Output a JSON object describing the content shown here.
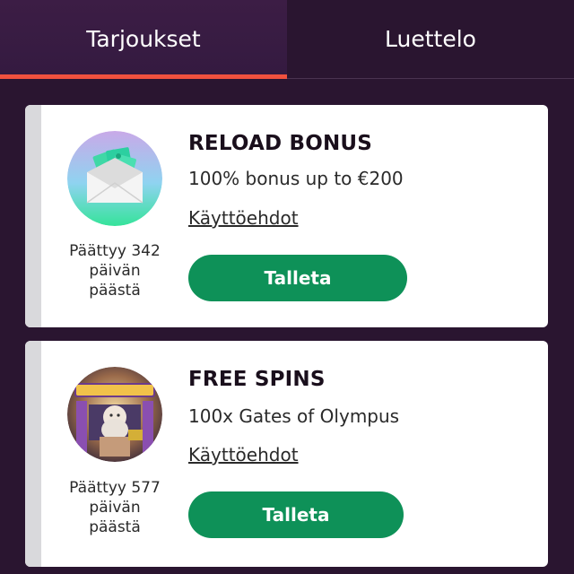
{
  "tabs": [
    {
      "label": "Tarjoukset",
      "active": true
    },
    {
      "label": "Luettelo",
      "active": false
    }
  ],
  "offers": [
    {
      "title": "RELOAD BONUS",
      "subtitle": "100% bonus up to €200",
      "terms_label": "Käyttöehdot",
      "expire_line1": "Päättyy 342",
      "expire_line2": "päivän",
      "expire_line3": "päästä",
      "button_label": "Talleta",
      "icon": "envelope-money-icon"
    },
    {
      "title": "FREE SPINS",
      "subtitle": "100x Gates of Olympus",
      "terms_label": "Käyttöehdot",
      "expire_line1": "Päättyy 577",
      "expire_line2": "päivän",
      "expire_line3": "päästä",
      "button_label": "Talleta",
      "icon": "gates-of-olympus-game-icon"
    }
  ],
  "colors": {
    "background": "#2a1530",
    "active_tab_indicator": "#f0513e",
    "button": "#0e9158",
    "card": "#ffffff"
  }
}
